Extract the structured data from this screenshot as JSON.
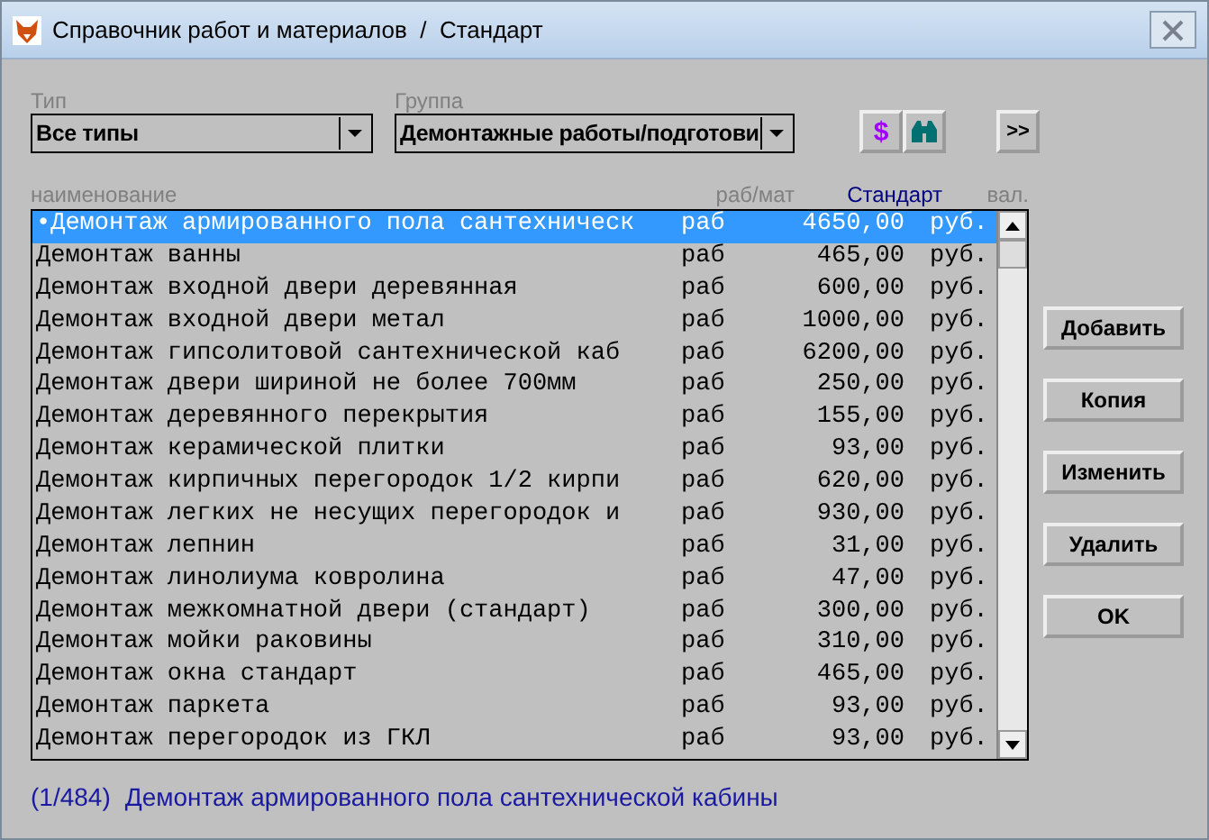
{
  "window": {
    "title": "Справочник работ и материалов  /  Стандарт"
  },
  "filters": [
    {
      "label": "Тип",
      "value": "Все типы"
    },
    {
      "label": "Группа",
      "value": "Демонтажные работы/подготови"
    }
  ],
  "toolbar": [
    {
      "kind": "dollar",
      "text": "$"
    },
    {
      "kind": "binoculars"
    },
    {
      "kind": "more",
      "text": ">>"
    }
  ],
  "table": {
    "columns": [
      {
        "label": "наименование",
        "sorted": false
      },
      {
        "label": "раб/мат",
        "sorted": false
      },
      {
        "label": "Стандарт",
        "sorted": true
      },
      {
        "label": "вал.",
        "sorted": false
      }
    ],
    "rows": [
      {
        "name": "•Демонтаж армированного пола сантехническ",
        "type": "раб",
        "price": "4650,00",
        "currency": "руб.",
        "selected": true
      },
      {
        "name": "Демонтаж ванны",
        "type": "раб",
        "price": "465,00",
        "currency": "руб.",
        "selected": false
      },
      {
        "name": "Демонтаж входной двери деревянная",
        "type": "раб",
        "price": "600,00",
        "currency": "руб.",
        "selected": false
      },
      {
        "name": "Демонтаж входной двери метал",
        "type": "раб",
        "price": "1000,00",
        "currency": "руб.",
        "selected": false
      },
      {
        "name": "Демонтаж гипсолитовой сантехнической каб",
        "type": "раб",
        "price": "6200,00",
        "currency": "руб.",
        "selected": false
      },
      {
        "name": "Демонтаж двери шириной не более 700мм",
        "type": "раб",
        "price": "250,00",
        "currency": "руб.",
        "selected": false
      },
      {
        "name": "Демонтаж деревянного перекрытия",
        "type": "раб",
        "price": "155,00",
        "currency": "руб.",
        "selected": false
      },
      {
        "name": "Демонтаж керамической плитки",
        "type": "раб",
        "price": "93,00",
        "currency": "руб.",
        "selected": false
      },
      {
        "name": "Демонтаж кирпичных перегородок 1/2 кирпи",
        "type": "раб",
        "price": "620,00",
        "currency": "руб.",
        "selected": false
      },
      {
        "name": "Демонтаж легких не несущих перегородок и",
        "type": "раб",
        "price": "930,00",
        "currency": "руб.",
        "selected": false
      },
      {
        "name": "Демонтаж лепнин",
        "type": "раб",
        "price": "31,00",
        "currency": "руб.",
        "selected": false
      },
      {
        "name": "Демонтаж линолиума ковролина",
        "type": "раб",
        "price": "47,00",
        "currency": "руб.",
        "selected": false
      },
      {
        "name": "Демонтаж межкомнатной двери (стандарт)",
        "type": "раб",
        "price": "300,00",
        "currency": "руб.",
        "selected": false
      },
      {
        "name": "Демонтаж мойки раковины",
        "type": "раб",
        "price": "310,00",
        "currency": "руб.",
        "selected": false
      },
      {
        "name": "Демонтаж окна стандарт",
        "type": "раб",
        "price": "465,00",
        "currency": "руб.",
        "selected": false
      },
      {
        "name": "Демонтаж паркета",
        "type": "раб",
        "price": "93,00",
        "currency": "руб.",
        "selected": false
      },
      {
        "name": "Демонтаж перегородок из ГКЛ",
        "type": "раб",
        "price": "93,00",
        "currency": "руб.",
        "selected": false
      }
    ]
  },
  "actions": [
    "Добавить",
    "Копия",
    "Изменить",
    "Удалить",
    "OK"
  ],
  "status_bar": {
    "position": "(1/484)",
    "text": "Демонтаж армированного пола сантехнической кабины"
  }
}
